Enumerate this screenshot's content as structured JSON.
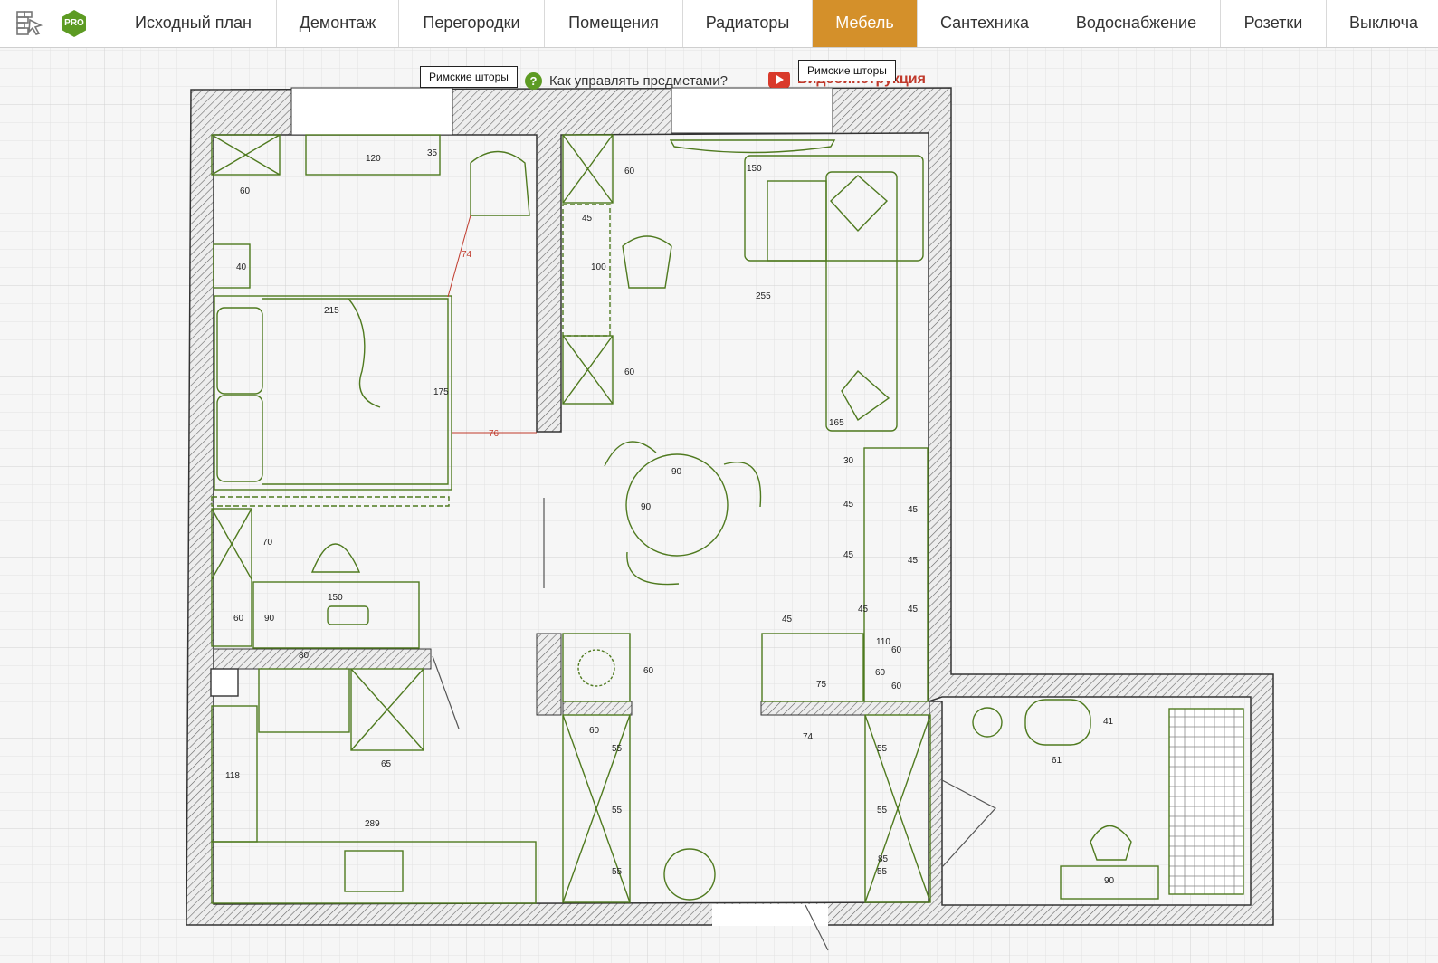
{
  "toolbar": {
    "pro_label": "PRO",
    "tabs": [
      {
        "label": "Исходный план"
      },
      {
        "label": "Демонтаж"
      },
      {
        "label": "Перегородки"
      },
      {
        "label": "Помещения"
      },
      {
        "label": "Радиаторы"
      },
      {
        "label": "Мебель"
      },
      {
        "label": "Сантехника"
      },
      {
        "label": "Водоснабжение"
      },
      {
        "label": "Розетки"
      },
      {
        "label": "Выключа"
      }
    ],
    "active_tab": "Мебель"
  },
  "help": {
    "question_text": "Как управлять предметами?",
    "video_text": "Видеоинструкция"
  },
  "tooltips": {
    "left": "Римские шторы",
    "right": "Римские шторы"
  },
  "plan": {
    "dims": {
      "d120": "120",
      "d35": "35",
      "d60a": "60",
      "d40": "40",
      "d74red": "74",
      "d215": "215",
      "d175": "175",
      "d76red": "76",
      "d70": "70",
      "d150desk": "150",
      "d60b": "60",
      "d90b": "90",
      "d80": "80",
      "d65": "65",
      "d118": "118",
      "d289": "289",
      "d60c": "60",
      "d45a": "45",
      "d100": "100",
      "d60d": "60",
      "d150sofa": "150",
      "d255": "255",
      "d165": "165",
      "d90c": "90",
      "d90d": "90",
      "d30": "30",
      "d45b": "45",
      "d45c": "45",
      "d45d": "45",
      "d45e": "45",
      "d45f": "45",
      "d45g": "45",
      "d45h": "45",
      "d110": "110",
      "d60e": "60",
      "d60f": "60",
      "d60g": "60",
      "d75": "75",
      "d60h": "60",
      "d74": "74",
      "d60i": "60",
      "d55a": "55",
      "d55b": "55",
      "d55c": "55",
      "d55d": "55",
      "d55e": "55",
      "d55f": "55",
      "d85": "85",
      "d41": "41",
      "d61": "61",
      "d90e": "90"
    }
  }
}
